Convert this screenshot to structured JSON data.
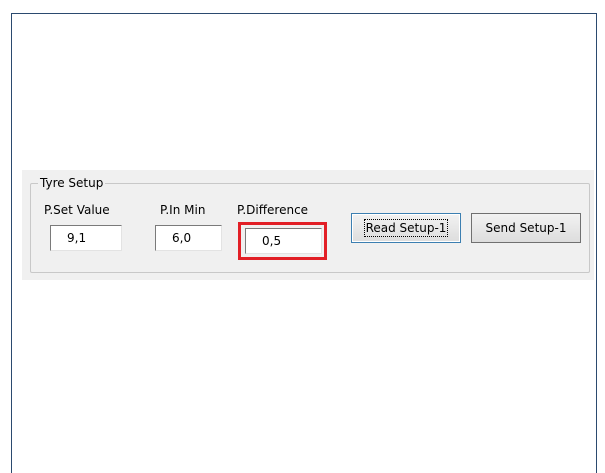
{
  "group": {
    "title": "Tyre Setup"
  },
  "fields": {
    "set_value": {
      "label": "P.Set Value",
      "value": "9,1"
    },
    "in_min": {
      "label": "P.In Min",
      "value": "6,0"
    },
    "difference": {
      "label": "P.Difference",
      "value": "0,5"
    }
  },
  "buttons": {
    "read_setup": "Read Setup-1",
    "send_setup": "Send Setup-1"
  },
  "colors": {
    "highlight": "#e21f26",
    "panel": "#f0f0f0",
    "window_border": "#2b4a6f"
  }
}
